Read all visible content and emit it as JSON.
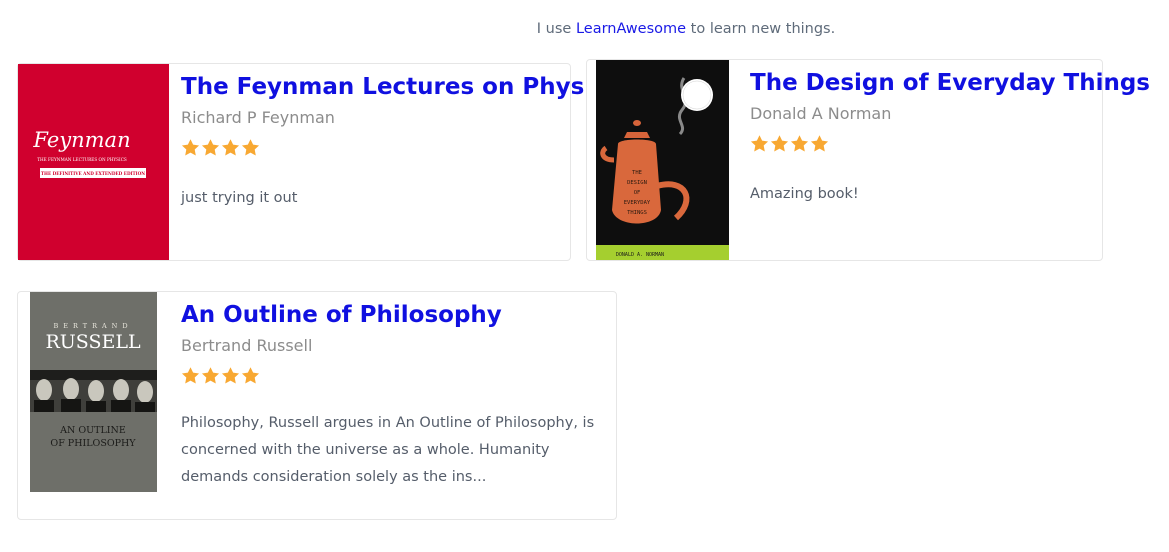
{
  "banner": {
    "prefix": "I use",
    "link": "LearnAwesome",
    "suffix": "to learn new things."
  },
  "books": [
    {
      "title": "The Feynman Lectures on Physics",
      "author": "Richard P Feynman",
      "rating": 4,
      "review": "just trying it out",
      "cover": {
        "script_title": "Feynman",
        "line1": "THE FEYNMAN LECTURES ON PHYSICS",
        "line2": "THE DEFINITIVE AND EXTENDED EDITION",
        "background": "#d0002e"
      }
    },
    {
      "title": "The Design of Everyday Things",
      "author": "Donald A Norman",
      "rating": 4,
      "review": "Amazing book!",
      "cover": {
        "lines": [
          "THE",
          "DESIGN",
          "OF",
          "EVERYDAY",
          "THINGS"
        ],
        "author_strip": "DONALD A. NORMAN",
        "background": "#0e0e0e",
        "accent": "#a5cf2f"
      }
    },
    {
      "title": "An Outline of Philosophy",
      "author": "Bertrand Russell",
      "rating": 4,
      "review": "Philosophy, Russell argues in An Outline of Philosophy, is concerned with the universe as a whole. Humanity demands consideration solely as the ins...",
      "cover": {
        "top": "BERTRAND",
        "name": "RUSSELL",
        "sub1": "AN OUTLINE",
        "sub2": "OF PHILOSOPHY",
        "background": "#6e6f69"
      }
    }
  ],
  "colors": {
    "title": "#1010e0",
    "author": "#8c8c8c",
    "star": "#f8a832",
    "text": "#555d6a"
  },
  "icons": {
    "star": "star-icon"
  }
}
